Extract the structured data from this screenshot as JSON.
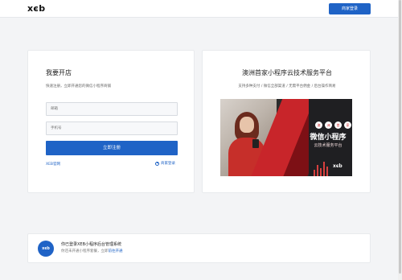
{
  "header": {
    "logo": "xєb",
    "merchant_login": "商家登录"
  },
  "left_card": {
    "title": "我要开店",
    "subtitle": "快速注册，立即开通您的微信小程序商铺",
    "email_placeholder": "邮箱",
    "phone_placeholder": "手机号",
    "register_button": "立即注册",
    "xeb_link": "XEB官网",
    "merchant_login_link": "商家登录"
  },
  "right_card": {
    "title": "澳洲首家小程序云技术服务平台",
    "subtitle": "支持多种支付 / 微信全部渠道 / 无需平台佣金 / 后台操作简易",
    "banner": {
      "chips": [
        "澳",
        "洲",
        "首",
        "家"
      ],
      "title": "微信小程序",
      "subtitle": "云技术服务平台",
      "logo": "xєb"
    }
  },
  "notice": {
    "avatar": "xєb",
    "title": "你已登录XEB小程序后台管理系统",
    "text_prefix": "你还未开通小程序套餐，立即",
    "link": "前往开通"
  },
  "colors": {
    "primary": "#1f63c6",
    "banner_red": "#c8252a"
  }
}
